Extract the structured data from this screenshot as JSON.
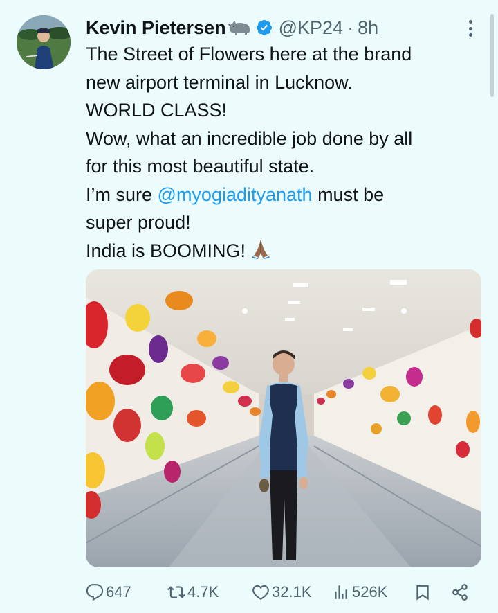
{
  "author": {
    "name": "Kevin Pietersen",
    "badge_emoji_icon": "rhino-icon",
    "verified_icon": "verified-badge-icon",
    "handle": "@KP24",
    "separator": "·",
    "time": "8h"
  },
  "tweet": {
    "lines": [
      "The Street of Flowers here at the brand",
      "new airport terminal in Lucknow.",
      "WORLD CLASS!",
      "Wow, what an incredible job done by all",
      "for this most beautiful state.",
      "I’m sure ",
      "super proud!",
      "India is BOOMING!"
    ],
    "mention": "@myogiadityanath",
    "mention_suffix": " must be",
    "emoji": "folded-hands-emoji"
  },
  "actions": {
    "replies": "647",
    "retweets": "4.7K",
    "likes": "32.1K",
    "views": "526K"
  },
  "colors": {
    "background": "#ecfbfb",
    "text": "#0f1419",
    "secondary": "#536471",
    "accent": "#1d9bf0"
  }
}
